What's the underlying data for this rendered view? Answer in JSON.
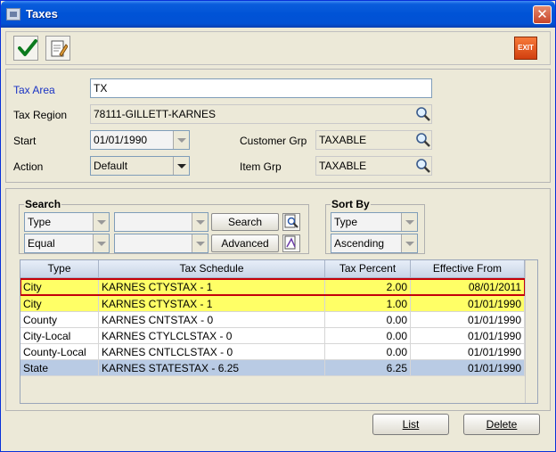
{
  "window": {
    "title": "Taxes",
    "close_label": "✕"
  },
  "toolbar": {
    "save_icon": "checkmark-icon",
    "edit_icon": "notepad-edit-icon",
    "exit_label": "EXIT"
  },
  "form": {
    "tax_area_label": "Tax Area",
    "tax_area_value": "TX",
    "tax_region_label": "Tax Region",
    "tax_region_value": "78111-GILLETT-KARNES",
    "start_label": "Start",
    "start_value": "01/01/1990",
    "customer_grp_label": "Customer Grp",
    "customer_grp_value": "TAXABLE",
    "action_label": "Action",
    "action_value": "Default",
    "item_grp_label": "Item Grp",
    "item_grp_value": "TAXABLE"
  },
  "search": {
    "title": "Search",
    "field1": "Type",
    "field2": "",
    "op1": "Equal",
    "op2": "",
    "search_label": "Search",
    "advanced_label": "Advanced"
  },
  "sort": {
    "title": "Sort By",
    "field": "Type",
    "order": "Ascending"
  },
  "table": {
    "columns": [
      "Type",
      "Tax Schedule",
      "Tax Percent",
      "Effective From"
    ],
    "rows": [
      {
        "type": "City",
        "schedule": "KARNES CTYSTAX - 1",
        "percent": "2.00",
        "from": "08/01/2011"
      },
      {
        "type": "City",
        "schedule": "KARNES CTYSTAX - 1",
        "percent": "1.00",
        "from": "01/01/1990"
      },
      {
        "type": "County",
        "schedule": "KARNES CNTSTAX - 0",
        "percent": "0.00",
        "from": "01/01/1990"
      },
      {
        "type": "City-Local",
        "schedule": "KARNES CTYLCLSTAX - 0",
        "percent": "0.00",
        "from": "01/01/1990"
      },
      {
        "type": "County-Local",
        "schedule": "KARNES CNTLCLSTAX - 0",
        "percent": "0.00",
        "from": "01/01/1990"
      },
      {
        "type": "State",
        "schedule": "KARNES STATESTAX - 6.25",
        "percent": "6.25",
        "from": "01/01/1990"
      }
    ]
  },
  "buttons": {
    "list": "List",
    "delete": "Delete"
  },
  "colors": {
    "title_blue": "#0053d6",
    "highlight_yellow": "#ffff66",
    "selected_row": "#b9cbe4",
    "outline_red": "#c4000b",
    "label_blue": "#1a33c4"
  }
}
